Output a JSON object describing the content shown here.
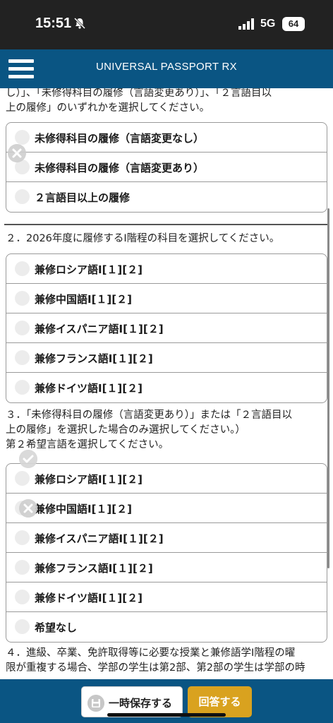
{
  "status_bar": {
    "time": "15:51",
    "network": "5G",
    "battery": "64"
  },
  "app": {
    "title": "UNIVERSAL PASSPORT RX"
  },
  "q1": {
    "text_line1": "し）」、「未修得科目の履修（言語変更あり）」、「２言語目以",
    "text_line2": "上の履修」のいずれかを選択してください。",
    "options": [
      "未修得科目の履修（言語変更なし）",
      "未修得科目の履修（言語変更あり）",
      "２言語目以上の履修"
    ]
  },
  "q2": {
    "text": "２．2026年度に履修するI階程の科目を選択してください。",
    "options": [
      "兼修ロシア語I[１][２]",
      "兼修中国語I[１][２]",
      "兼修イスパニア語I[１][２]",
      "兼修フランス語I[１][２]",
      "兼修ドイツ語I[１][２]"
    ]
  },
  "q3": {
    "text_line1": "３．「未修得科目の履修（言語変更あり）」または「２言語目以",
    "text_line2": "上の履修」を選択した場合のみ選択してください。）",
    "text_line3": "第２希望言語を選択してください。",
    "options": [
      "兼修ロシア語I[１][２]",
      "兼修中国語I[１][２]",
      "兼修イスパニア語I[１][２]",
      "兼修フランス語I[１][２]",
      "兼修ドイツ語I[１][２]",
      "希望なし"
    ]
  },
  "q4": {
    "text_line1": "４．進級、卒業、免許取得等に必要な授業と兼修語学I階程の曜",
    "text_line2": "限が重複する場合、学部の学生は第2部、第2部の学生は学部の時"
  },
  "footer": {
    "save_label": "一時保存する",
    "answer_label": "回答する"
  },
  "colors": {
    "header": "#0a5583",
    "accent": "#d9a21f"
  }
}
